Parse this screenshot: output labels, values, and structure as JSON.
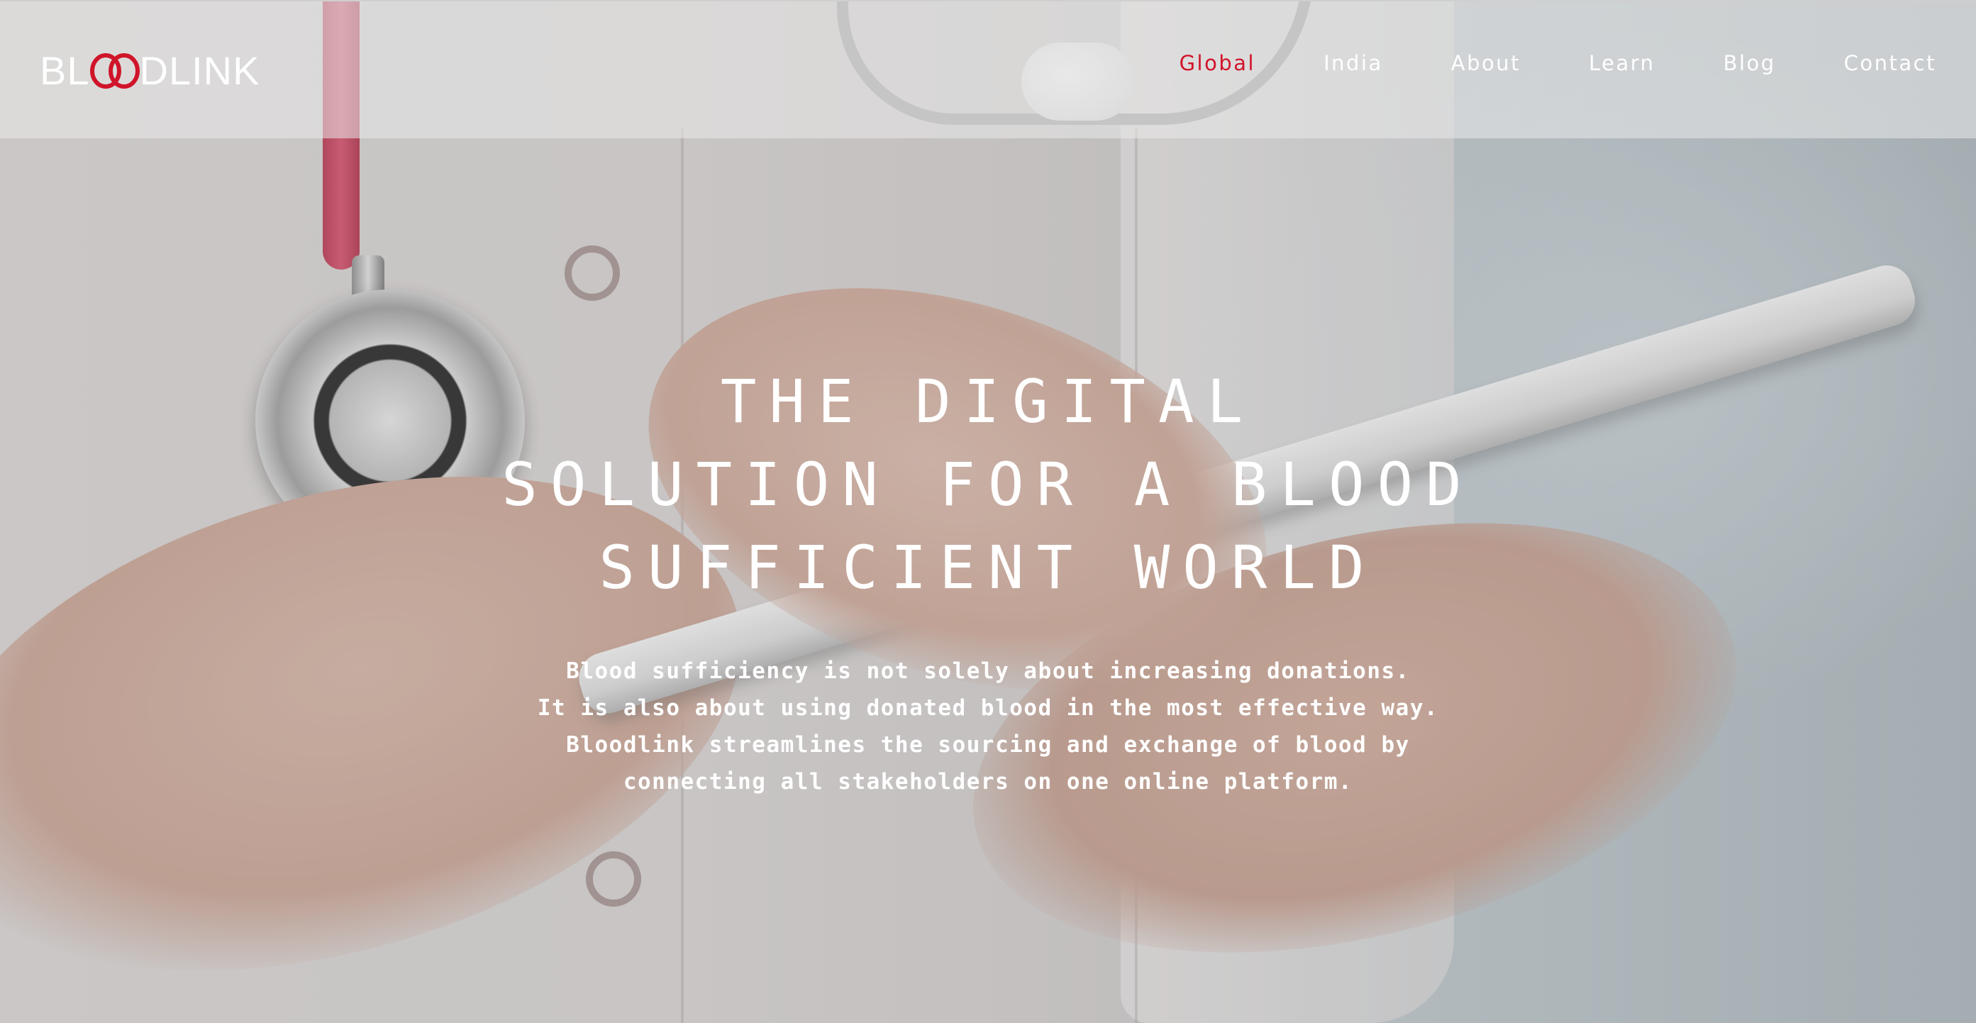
{
  "brand": {
    "logo_prefix": "BL",
    "logo_suffix": "DLINK",
    "accent_color": "#d01429"
  },
  "nav": {
    "items": [
      {
        "label": "Global",
        "active": true
      },
      {
        "label": "India",
        "active": false
      },
      {
        "label": "About",
        "active": false
      },
      {
        "label": "Learn",
        "active": false
      },
      {
        "label": "Blog",
        "active": false
      },
      {
        "label": "Contact",
        "active": false
      }
    ]
  },
  "hero": {
    "headline_lines": [
      "THE DIGITAL",
      "SOLUTION FOR A BLOOD",
      "SUFFICIENT WORLD"
    ],
    "body_lines": [
      "Blood sufficiency is not solely about increasing donations.",
      "It is also about using donated blood in the most effective way.",
      "Bloodlink streamlines the sourcing and exchange of blood by",
      "connecting all stakeholders on one online platform."
    ]
  }
}
